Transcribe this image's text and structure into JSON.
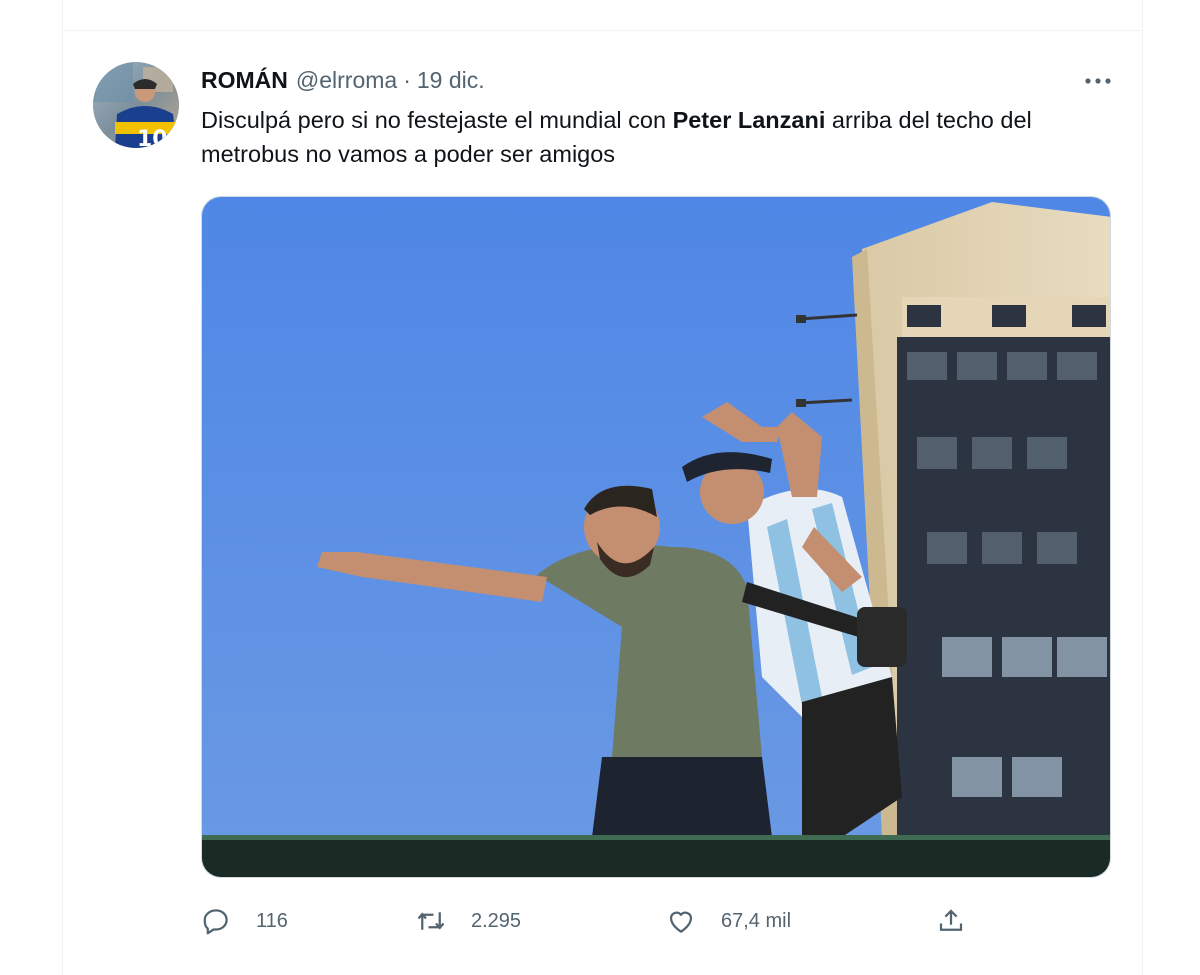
{
  "tweet": {
    "author_name": "ROMÁN",
    "author_handle": "@elrroma",
    "separator": "·",
    "timestamp": "19 dic.",
    "text_before": "Disculpá pero si no festejaste el mundial con ",
    "text_bold": "Peter Lanzani",
    "text_after": " arriba del techo del metrobus no vamos a poder ser amigos",
    "media_description_icon": "photo"
  },
  "actions": {
    "reply_count": "116",
    "retweet_count": "2.295",
    "like_count": "67,4 mil"
  },
  "icons": {
    "more": "more-horizontal-icon",
    "reply": "reply-icon",
    "retweet": "retweet-icon",
    "like": "heart-icon",
    "share": "share-icon"
  },
  "colors": {
    "text_primary": "#0f1419",
    "text_secondary": "#536471",
    "border": "#eff3f4",
    "sky": "#5a8fe6"
  }
}
